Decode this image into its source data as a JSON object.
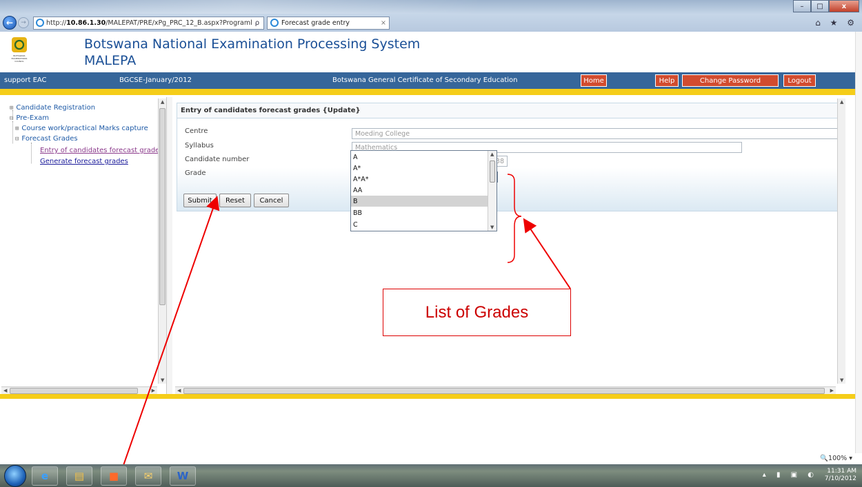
{
  "browser": {
    "url_prefix": "http://",
    "url_host": "10.86.1.30",
    "url_rest": "/MALEPAT/PRE/xPg_PRC_12_B.aspx?Programl",
    "url_icons": "ρ ▾ ▣ C ✕",
    "tab_title": "Forecast grade entry",
    "tab_close": "×",
    "window_buttons": {
      "minimize": "–",
      "maximize": "□",
      "close": "x"
    },
    "right_tools": "⌂ ★ ⚙",
    "back_glyph": "←",
    "forward_glyph": "→"
  },
  "header": {
    "title_line1": "Botswana National Examination Processing System",
    "title_line2": "MALEPA",
    "logo_caption": "BOTSWANA EXAMINATIONS COUNCIL"
  },
  "nav_bar": {
    "user": "support EAC",
    "session": "BGCSE-January/2012",
    "qualification": "Botswana General Certificate of Secondary Education",
    "buttons": {
      "home": "Home",
      "help": "Help",
      "change_password": "Change Password",
      "logout": "Logout"
    }
  },
  "tree": {
    "items": [
      {
        "label": "Candidate Registration",
        "toggle": "⊞"
      },
      {
        "label": "Pre-Exam",
        "toggle": "⊟"
      },
      {
        "label": "Course work/practical Marks capture",
        "toggle": "⊞"
      },
      {
        "label": "Forecast Grades",
        "toggle": "⊟"
      },
      {
        "label": "Entry of candidates forecast grades"
      },
      {
        "label": "Generate forecast grades"
      }
    ]
  },
  "form": {
    "heading": "Entry of candidates forecast grades {Update}",
    "centre_label": "Centre",
    "centre_value": "Moeding College",
    "syllabus_label": "Syllabus",
    "syllabus_value": "Mathematics",
    "candidate_label": "Candidate number",
    "candidate_value": "038",
    "grade_label": "Grade",
    "grade_value": "",
    "submit": "Submit",
    "reset": "Reset",
    "cancel": "Cancel"
  },
  "grade_options": [
    "A",
    "A*",
    "A*A*",
    "AA",
    "B",
    "BB",
    "C"
  ],
  "grade_selected": "B",
  "annotation": {
    "label": "List of Grades"
  },
  "status": {
    "zoom": "100%",
    "zoom_icon": "🔍"
  },
  "taskbar": {
    "time": "11:31 AM",
    "date": "7/10/2012",
    "icons": [
      "ie-icon",
      "explorer-icon",
      "office-icon",
      "outlook-icon",
      "word-icon"
    ]
  },
  "colors": {
    "header_blue": "#36669a",
    "accent_yellow": "#f5cd19",
    "title_blue": "#1a4f96",
    "button_red": "#d24c2f",
    "annotation_red": "#d00000"
  }
}
